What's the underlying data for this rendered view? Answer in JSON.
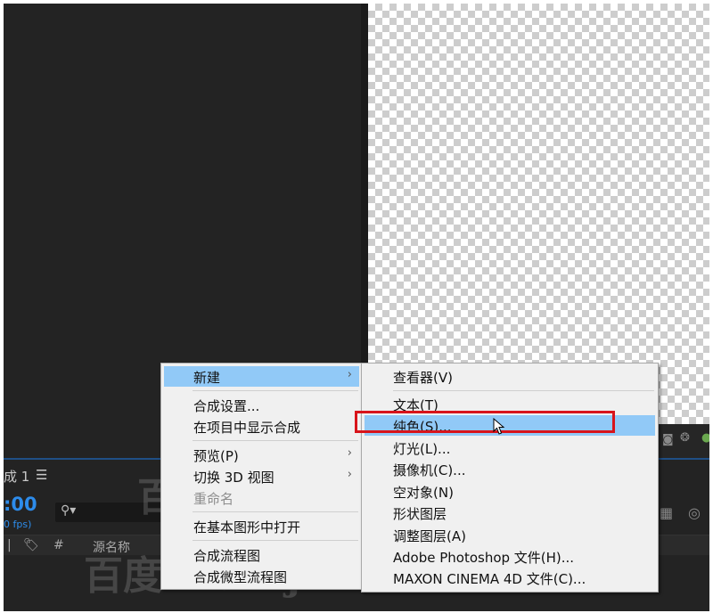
{
  "composition_panel": {
    "tab_label": "成 1",
    "tab_menu_icon": "hamburger-icon",
    "timecode": ":00",
    "fps": "0 fps)",
    "search_icon": "search-icon",
    "columns": {
      "number": "#",
      "source_name": "源名称"
    }
  },
  "context_menu": {
    "items": [
      {
        "label": "新建",
        "submenu": true,
        "highlighted": true
      },
      {
        "label": "合成设置..."
      },
      {
        "label": "在项目中显示合成"
      },
      {
        "label": "预览(P)",
        "submenu": true
      },
      {
        "label": "切换 3D 视图",
        "submenu": true
      },
      {
        "label": "重命名",
        "disabled": true
      },
      {
        "label": "在基本图形中打开"
      },
      {
        "label": "合成流程图"
      },
      {
        "label": "合成微型流程图"
      }
    ],
    "arrow": "›"
  },
  "submenu": {
    "items": [
      {
        "label": "查看器(V)"
      },
      {
        "label": "文本(T)"
      },
      {
        "label": "纯色(S)...",
        "highlighted": true
      },
      {
        "label": "灯光(L)..."
      },
      {
        "label": "摄像机(C)..."
      },
      {
        "label": "空对象(N)"
      },
      {
        "label": "形状图层"
      },
      {
        "label": "调整图层(A)"
      },
      {
        "label": "Adobe Photoshop 文件(H)..."
      },
      {
        "label": "MAXON CINEMA 4D 文件(C)..."
      }
    ]
  },
  "watermark": {
    "text1": "百度ID：ffjczr",
    "text2": "百度ID：ffjczr"
  },
  "colors": {
    "highlight": "#91c9f7",
    "annotation": "#d8141b",
    "timecode": "#2d8ceb"
  }
}
